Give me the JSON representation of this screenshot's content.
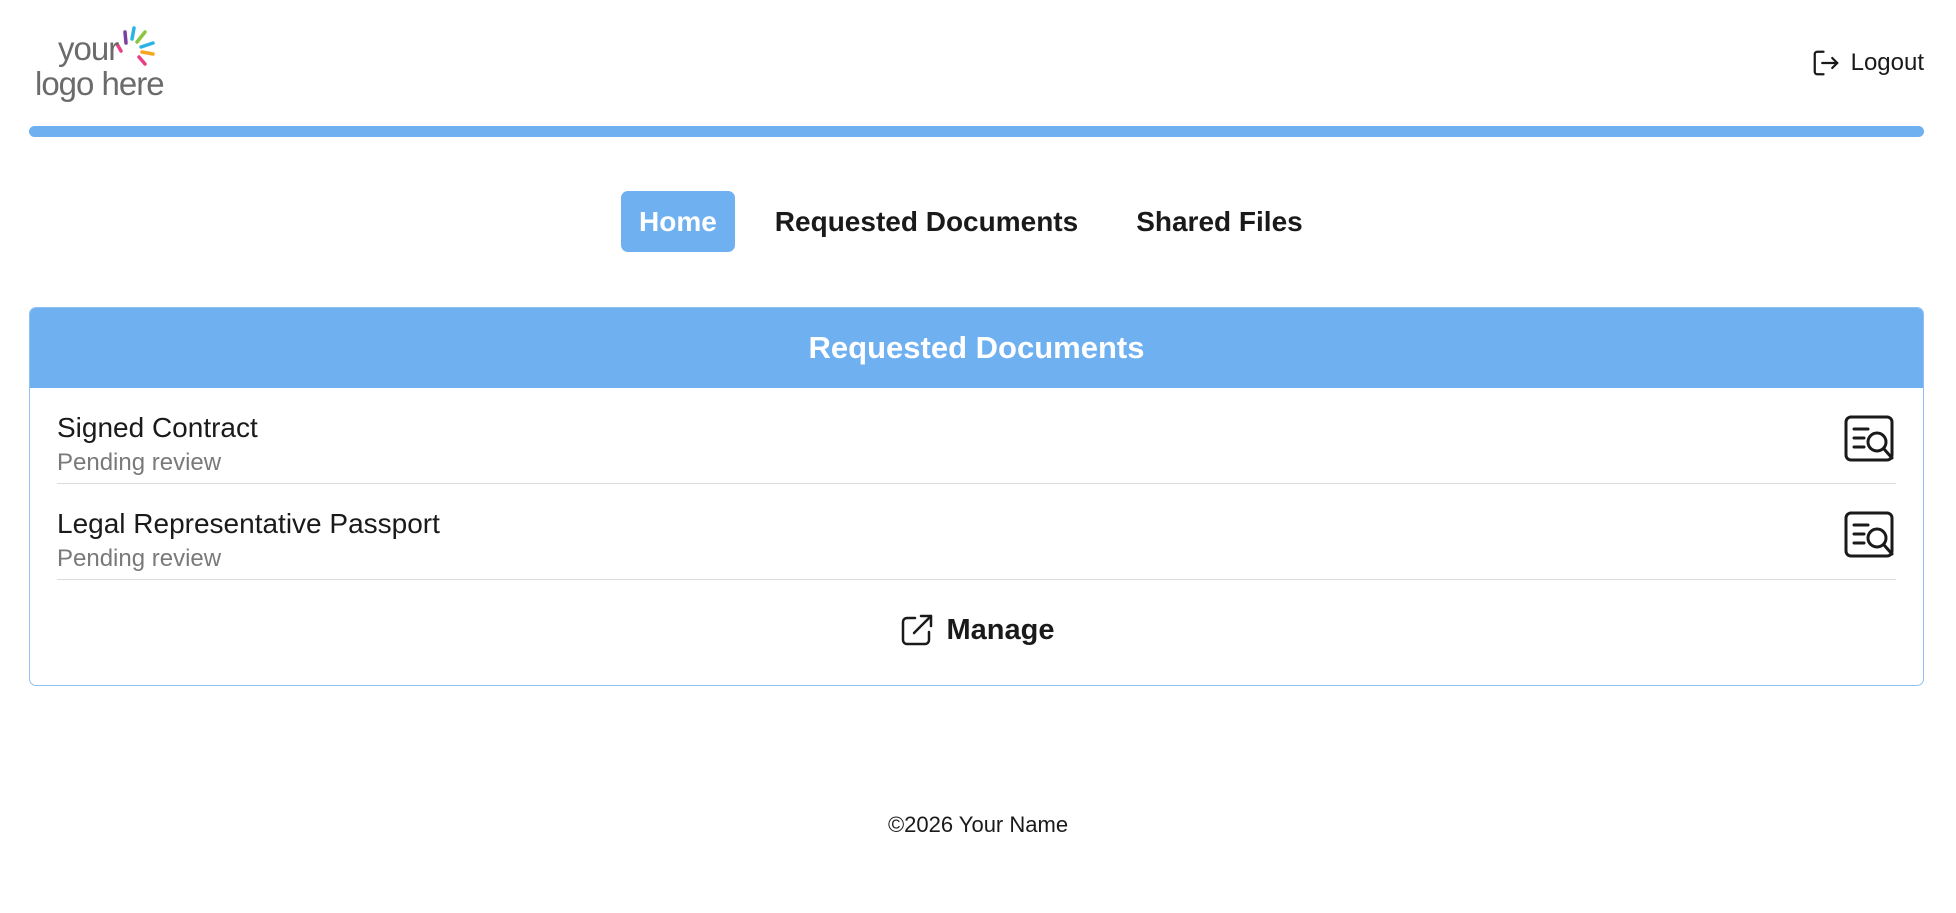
{
  "header": {
    "logo": {
      "line1": "your",
      "line2": "logo here"
    },
    "logout_label": "Logout"
  },
  "nav": {
    "items": [
      {
        "label": "Home",
        "active": true
      },
      {
        "label": "Requested Documents",
        "active": false
      },
      {
        "label": "Shared Files",
        "active": false
      }
    ]
  },
  "card": {
    "title": "Requested Documents",
    "documents": [
      {
        "title": "Signed Contract",
        "status": "Pending review",
        "action_icon": "document-search-icon"
      },
      {
        "title": "Legal Representative Passport",
        "status": "Pending review",
        "action_icon": "document-search-icon"
      }
    ],
    "manage_label": "Manage",
    "manage_icon": "external-link-icon"
  },
  "footer": {
    "text": "©2026 Your Name"
  },
  "colors": {
    "accent": "#6fb0f0",
    "text": "#1a1a1a",
    "muted": "#7a7a7a",
    "logo_text": "#6b6b6b"
  }
}
